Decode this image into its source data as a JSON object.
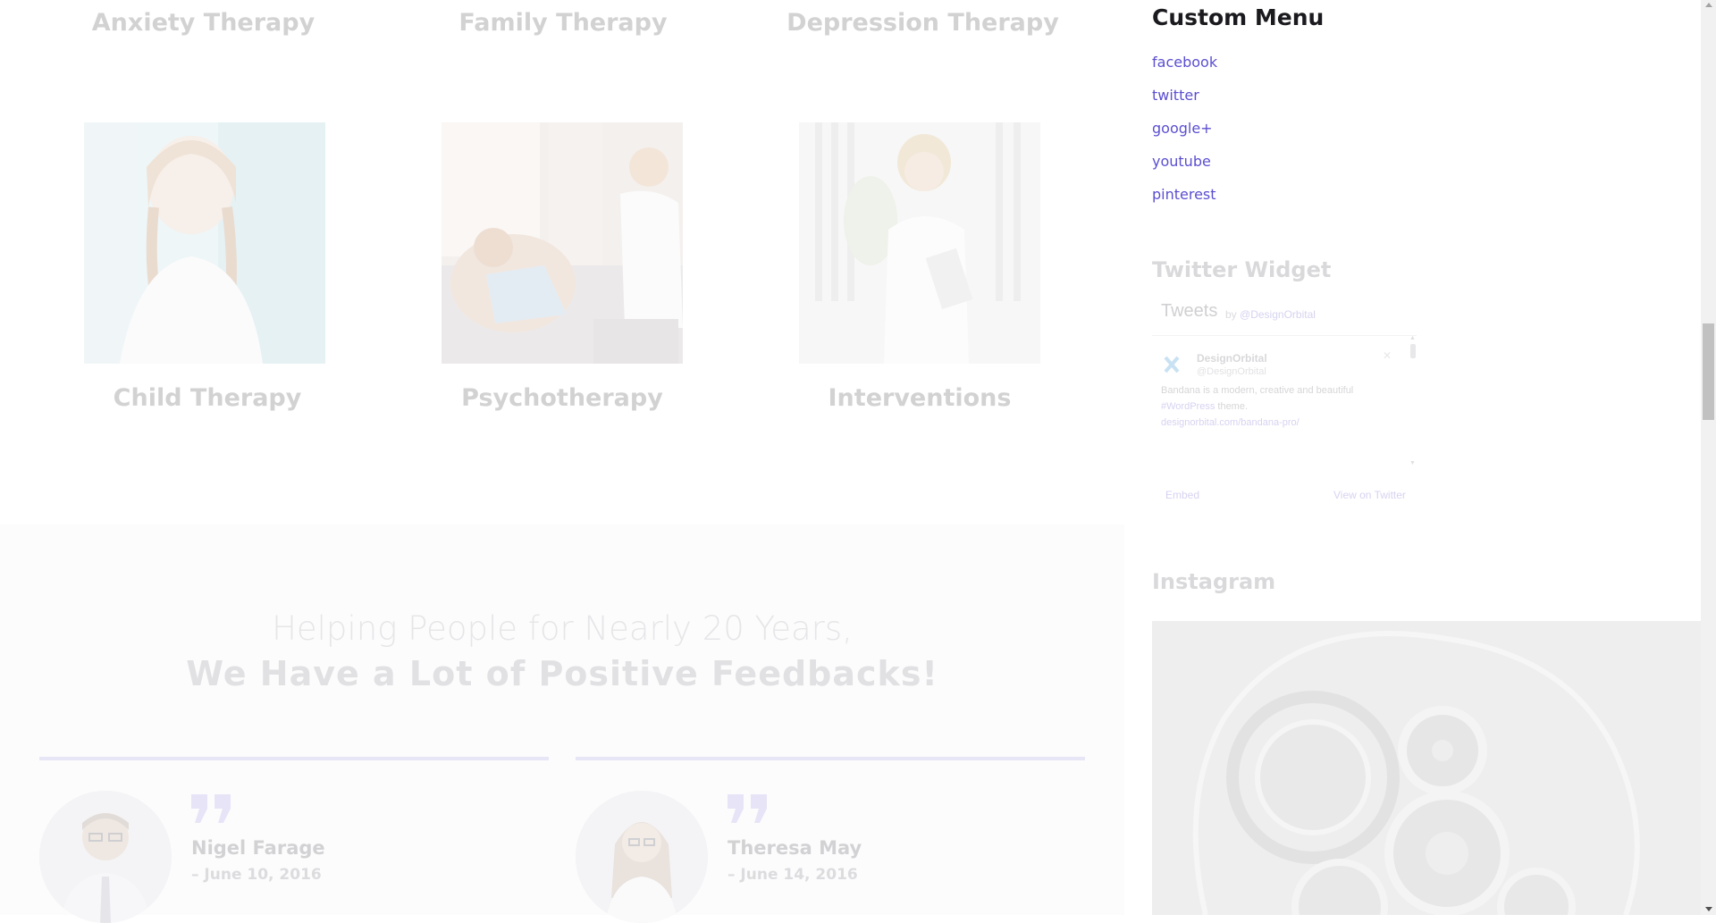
{
  "services_row1": [
    "Anxiety Therapy",
    "Family Therapy",
    "Depression Therapy"
  ],
  "services_row2": [
    "Child Therapy",
    "Psychotherapy",
    "Interventions"
  ],
  "testimonials": {
    "heading_light": "Helping People for Nearly 20 Years,",
    "heading_bold": "We Have a Lot of Positive Feedbacks!",
    "items": [
      {
        "name": "Nigel Farage",
        "date": "– June 10, 2016"
      },
      {
        "name": "Theresa May",
        "date": "– June 14, 2016"
      }
    ]
  },
  "sidebar": {
    "custom_menu": {
      "title": "Custom Menu",
      "items": [
        "facebook",
        "twitter",
        "google+",
        "youtube",
        "pinterest"
      ]
    },
    "twitter": {
      "title": "Twitter Widget",
      "tweets_label": "Tweets",
      "by_label": "by",
      "by_handle": "@DesignOrbital",
      "author": "DesignOrbital",
      "handle": "@DesignOrbital",
      "tweet_line1": "Bandana is a modern, creative and beautiful",
      "tweet_hashtag": "#WordPress",
      "tweet_after_hashtag": "theme.",
      "tweet_link": "designorbital.com/bandana-pro/",
      "embed": "Embed",
      "view_on": "View on Twitter"
    },
    "instagram": {
      "title": "Instagram"
    }
  },
  "colors": {
    "accent": "#5b4fd0",
    "title_dark": "#1b1b1f",
    "faded_text": "#d2d2d2",
    "quote_mark": "#e7e4f7"
  },
  "icons": {
    "quote": "double-quote-icon",
    "twitter_avatar": "x-logo-icon",
    "close": "close-icon"
  }
}
